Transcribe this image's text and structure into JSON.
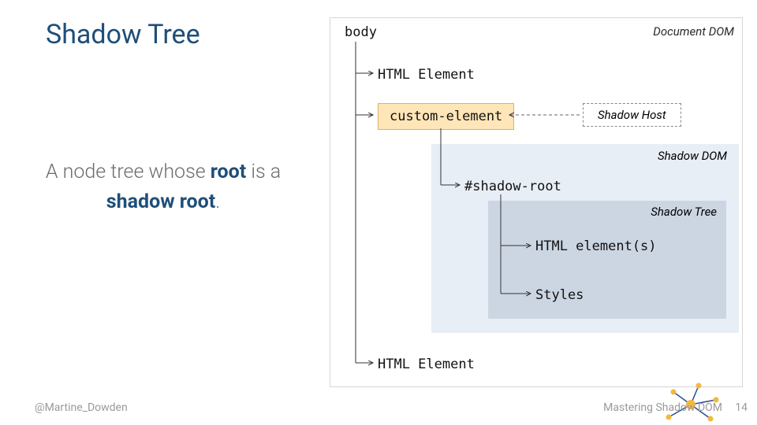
{
  "title": "Shadow Tree",
  "description": {
    "pre": "A node tree whose ",
    "strong1": "root",
    "mid": " is a ",
    "strong2": "shadow root",
    "post": "."
  },
  "diagram": {
    "doc_dom": "Document DOM",
    "body": "body",
    "html_element": "HTML Element",
    "custom_element": "custom-element",
    "shadow_host": "Shadow Host",
    "shadow_dom": "Shadow DOM",
    "shadow_root": "#shadow-root",
    "shadow_tree": "Shadow Tree",
    "html_elements": "HTML element(s)",
    "styles": "Styles"
  },
  "footer": {
    "handle": "@Martine_Dowden",
    "deck": "Mastering Shadow DOM",
    "page": "14"
  }
}
